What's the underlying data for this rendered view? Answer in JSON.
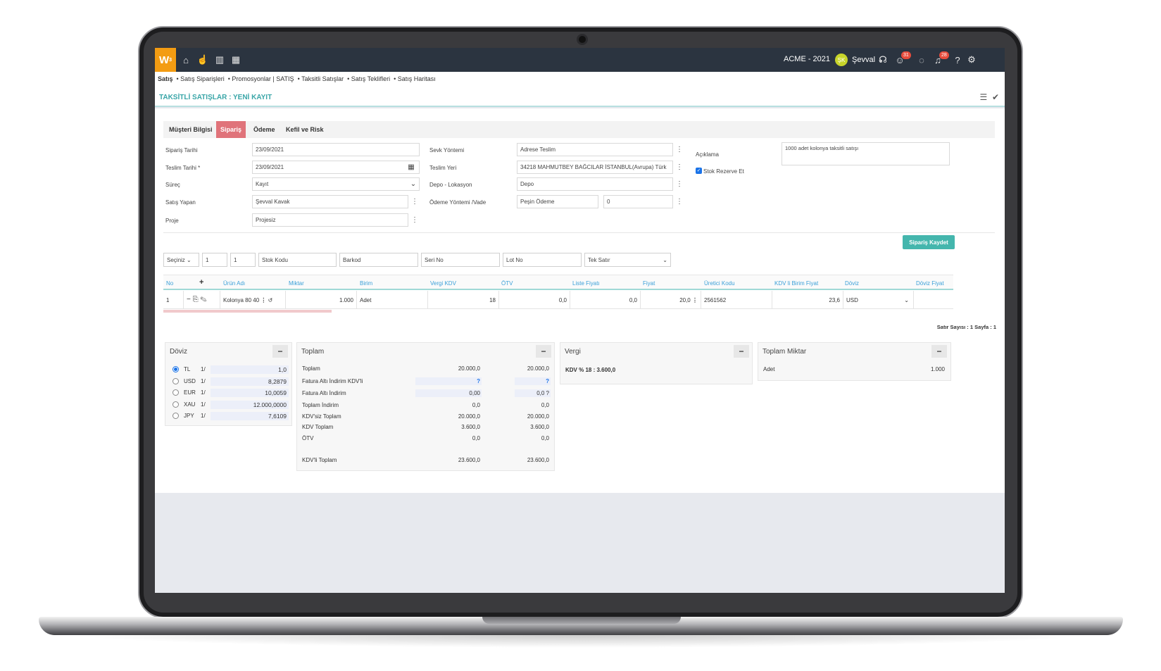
{
  "topbar": {
    "logo": "W",
    "company": "ACME - 2021",
    "user_initials": "ŞK",
    "user_name": "Şevval",
    "badge_messages": "31",
    "badge_notifications": "28"
  },
  "breadcrumb": {
    "root": "Satış",
    "items": [
      "Satış Siparişleri",
      "Promosyonlar | SATIŞ",
      "Taksitli Satışlar",
      "Satış Teklifleri",
      "Satış Haritası"
    ]
  },
  "page": {
    "title": "TAKSİTLİ SATIŞLAR : YENİ KAYIT"
  },
  "tabs": [
    "Müşteri Bilgisi",
    "Sipariş",
    "Ödeme",
    "Kefil ve Risk"
  ],
  "form": {
    "siparis_tarihi_label": "Sipariş Tarihi",
    "siparis_tarihi": "23/09/2021",
    "teslim_tarihi_label": "Teslim Tarihi *",
    "teslim_tarihi": "23/09/2021",
    "surec_label": "Süreç",
    "surec": "Kayıt",
    "satis_yapan_label": "Satış Yapan",
    "satis_yapan": "Şevval Kavak",
    "proje_label": "Proje",
    "proje": "Projesiz",
    "sevk_label": "Sevk Yöntemi",
    "sevk": "Adrese Teslim",
    "teslim_yeri_label": "Teslim Yeri",
    "teslim_yeri": "34218 MAHMUTBEY BAĞCILAR İSTANBUL(Avrupa) Türk",
    "depo_label": "Depo - Lokasyon",
    "depo": "Depo",
    "odeme_label": "Ödeme Yöntemi /Vade",
    "odeme": "Peşin Ödeme",
    "vade": "0",
    "aciklama_label": "Açıklama",
    "aciklama": "1000 adet kolonya taksitli satışı",
    "stok_rezerve_label": "Stok Rezerve Et"
  },
  "save_button": "Sipariş Kaydet",
  "filters": {
    "seciniz": "Seçiniz",
    "qty1": "1",
    "qty2": "1",
    "stok_kodu": "Stok Kodu",
    "barkod": "Barkod",
    "seri_no": "Seri No",
    "lot_no": "Lot No",
    "tek_satir": "Tek Satır"
  },
  "grid": {
    "headers": [
      "No",
      "+",
      "Ürün Adı",
      "Miktar",
      "Birim",
      "Vergi KDV",
      "ÖTV",
      "Liste Fiyatı",
      "Fiyat",
      "Üretici Kodu",
      "KDV li Birim Fiyat",
      "Döviz",
      "Döviz Fiyat"
    ],
    "row": {
      "no": "1",
      "urun": "Kolonya 80 40",
      "miktar": "1.000",
      "birim": "Adet",
      "kdv": "18",
      "otv": "0,0",
      "liste": "0,0",
      "fiyat": "20,0",
      "uretici": "2561562",
      "kdvli": "23,6",
      "doviz": "USD"
    },
    "row_count": "Satır Sayısı : 1 Sayfa : 1"
  },
  "doviz_panel": {
    "title": "Döviz",
    "rates": [
      {
        "code": "TL",
        "unit": "1/",
        "value": "1,0",
        "selected": true
      },
      {
        "code": "USD",
        "unit": "1/",
        "value": "8,2879",
        "selected": false
      },
      {
        "code": "EUR",
        "unit": "1/",
        "value": "10,0059",
        "selected": false
      },
      {
        "code": "XAU",
        "unit": "1/",
        "value": "12.000,0000",
        "selected": false
      },
      {
        "code": "JPY",
        "unit": "1/",
        "value": "7,6109",
        "selected": false
      }
    ]
  },
  "toplam_panel": {
    "title": "Toplam",
    "rows": [
      {
        "label": "Toplam",
        "v1": "20.000,0",
        "v2": "20.000,0"
      },
      {
        "label": "Fatura Altı İndirim KDV'li",
        "v1": "?",
        "v2": "?"
      },
      {
        "label": "Fatura Altı İndirim",
        "v1": "0,00",
        "v2": "0,0 ?"
      },
      {
        "label": "Toplam İndirim",
        "v1": "0,0",
        "v2": "0,0"
      },
      {
        "label": "KDV'siz Toplam",
        "v1": "20.000,0",
        "v2": "20.000,0"
      },
      {
        "label": "KDV Toplam",
        "v1": "3.600,0",
        "v2": "3.600,0"
      },
      {
        "label": "ÖTV",
        "v1": "0,0",
        "v2": "0,0"
      },
      {
        "label": "KDV'li Toplam",
        "v1": "23.600,0",
        "v2": "23.600,0"
      }
    ]
  },
  "vergi_panel": {
    "title": "Vergi",
    "text": "KDV % 18 : 3.600,0"
  },
  "miktar_panel": {
    "title": "Toplam Miktar",
    "label": "Adet",
    "value": "1.000"
  }
}
